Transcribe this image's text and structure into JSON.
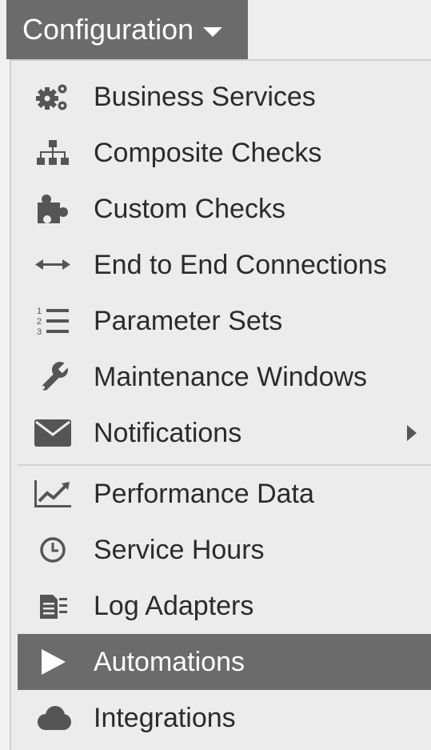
{
  "header": {
    "button_label": "Configuration"
  },
  "menu": {
    "items": [
      {
        "label": "Business Services",
        "icon": "gears-icon"
      },
      {
        "label": "Composite Checks",
        "icon": "sitemap-icon"
      },
      {
        "label": "Custom Checks",
        "icon": "puzzle-piece-icon"
      },
      {
        "label": "End to End Connections",
        "icon": "double-arrow-icon"
      },
      {
        "label": "Parameter Sets",
        "icon": "numbered-list-icon"
      },
      {
        "label": "Maintenance Windows",
        "icon": "wrench-icon"
      },
      {
        "label": "Notifications",
        "icon": "envelope-icon",
        "has_submenu": true
      },
      {
        "label": "Performance Data",
        "icon": "line-chart-icon"
      },
      {
        "label": "Service Hours",
        "icon": "clock-icon"
      },
      {
        "label": "Log Adapters",
        "icon": "log-file-icon"
      },
      {
        "label": "Automations",
        "icon": "play-icon",
        "active": true
      },
      {
        "label": "Integrations",
        "icon": "cloud-icon"
      }
    ]
  },
  "colors": {
    "header_bg": "#6b6b6b",
    "active_bg": "#6b6b6b",
    "menu_bg": "#ececec",
    "text": "#2b2b2b",
    "icon": "#555555"
  }
}
